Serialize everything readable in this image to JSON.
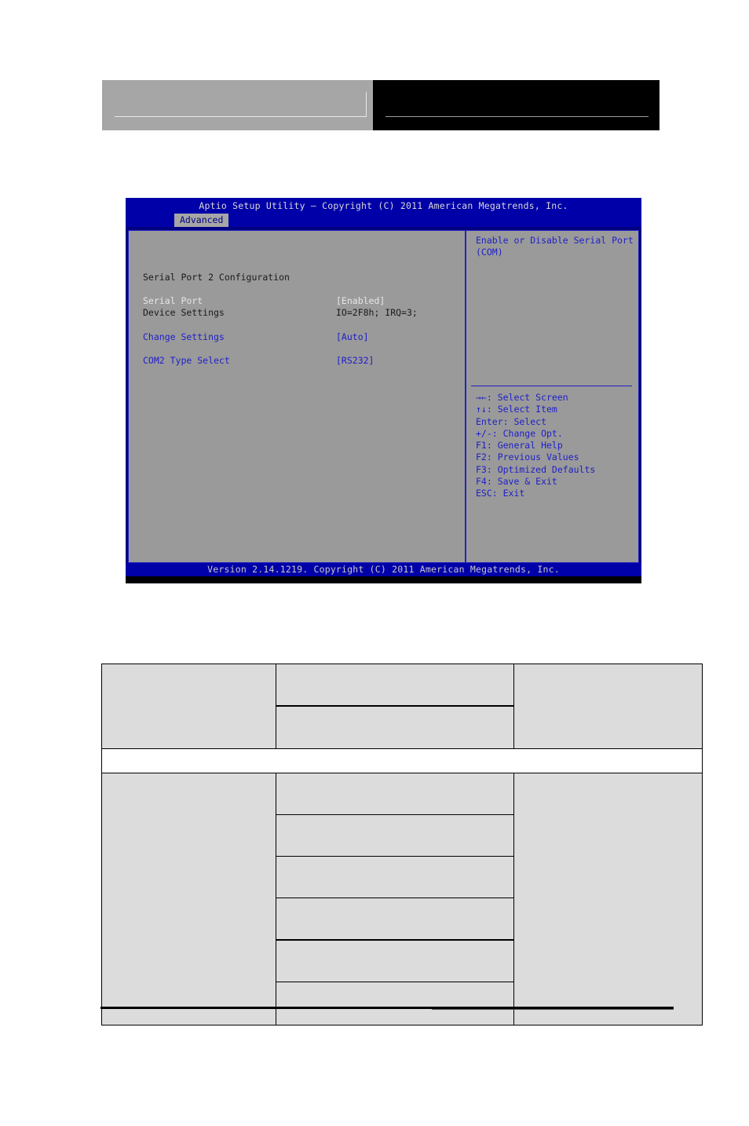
{
  "page_header": {
    "left_block_text": "",
    "right_block_text": ""
  },
  "bios": {
    "title": "Aptio Setup Utility – Copyright (C) 2011 American Megatrends, Inc.",
    "active_tab": "Advanced",
    "section_title": "Serial Port 2 Configuration",
    "options": [
      {
        "label": "Serial Port",
        "value": "[Enabled]",
        "label_color": "white",
        "value_color": "white"
      },
      {
        "label": "Device Settings",
        "value": "IO=2F8h; IRQ=3;",
        "label_color": "dark",
        "value_color": "dark"
      },
      {
        "label": "Change Settings",
        "value": "[Auto]",
        "label_color": "blue",
        "value_color": "blue"
      },
      {
        "label": "COM2 Type Select",
        "value": "[RS232]",
        "label_color": "blue",
        "value_color": "blue"
      }
    ],
    "help": {
      "line1": "Enable or Disable Serial Port",
      "line2": "(COM)"
    },
    "keys": [
      "→←: Select Screen",
      "↑↓: Select Item",
      "Enter: Select",
      "+/-: Change Opt.",
      "F1: General Help",
      "F2: Previous Values",
      "F3: Optimized Defaults",
      "F4: Save & Exit",
      "ESC: Exit"
    ],
    "footer": "Version 2.14.1219. Copyright (C) 2011 American Megatrends, Inc."
  },
  "table_top": {
    "cells": {
      "r1c1": "",
      "r1c2": "",
      "r2c2": "",
      "r1c3": "",
      "full_row": ""
    }
  },
  "table_bottom": {
    "cells": {
      "c1": "",
      "c3": "",
      "c2_rows": [
        "",
        "",
        "",
        "",
        "",
        ""
      ]
    }
  },
  "colors": {
    "bios_blue": "#0000a8",
    "bios_gray": "#9a9a9a",
    "bios_link_blue": "#2020c8",
    "table_cell_gray": "#dcdcdc"
  }
}
